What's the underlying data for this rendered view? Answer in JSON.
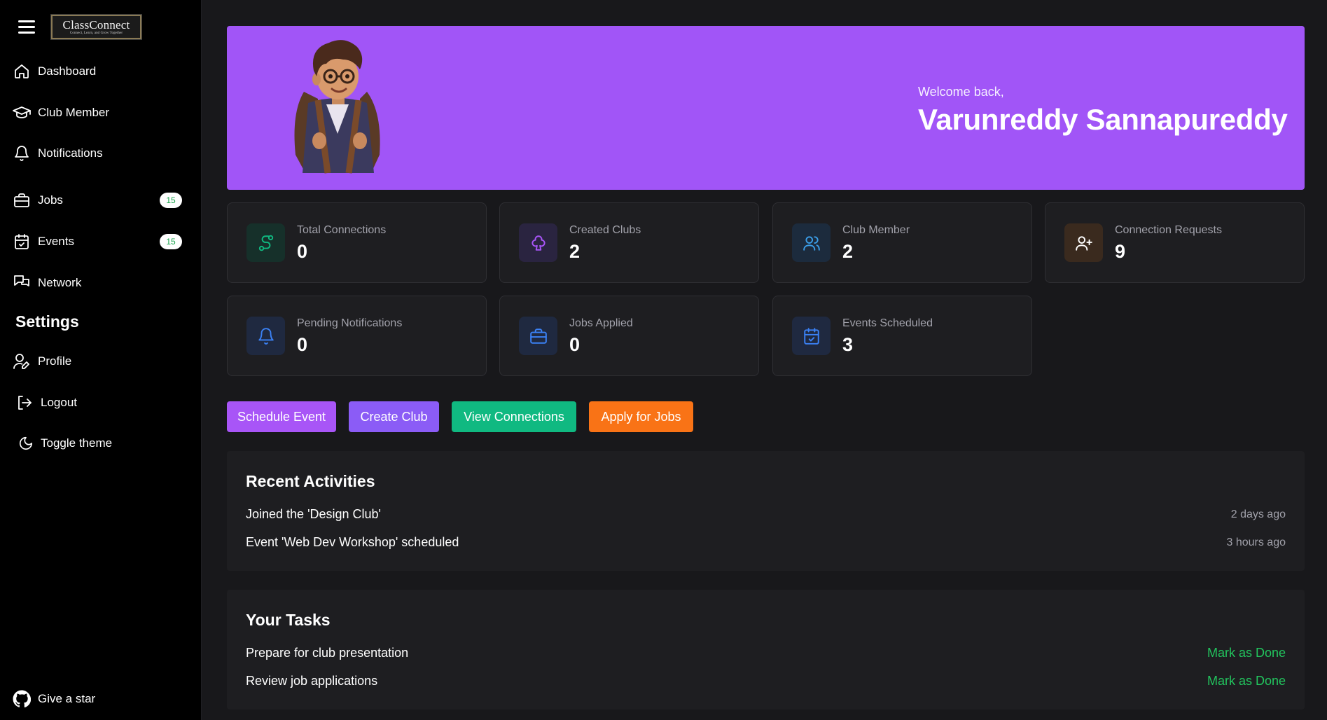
{
  "logo": {
    "title": "ClassConnect",
    "tagline": "Connect, Learn, and Grow Together"
  },
  "sidebar": {
    "items": [
      {
        "label": "Dashboard",
        "icon": "home-icon"
      },
      {
        "label": "Club Member",
        "icon": "graduation-cap-icon"
      },
      {
        "label": "Notifications",
        "icon": "bell-icon"
      },
      {
        "label": "Jobs",
        "icon": "briefcase-icon",
        "badge": "15"
      },
      {
        "label": "Events",
        "icon": "calendar-check-icon",
        "badge": "15"
      },
      {
        "label": "Network",
        "icon": "messages-icon"
      }
    ],
    "settings_title": "Settings",
    "settings_items": [
      {
        "label": "Profile",
        "icon": "user-pen-icon"
      },
      {
        "label": "Logout",
        "icon": "logout-icon"
      },
      {
        "label": "Toggle theme",
        "icon": "moon-icon"
      }
    ],
    "footer": {
      "label": "Give a star",
      "icon": "github-icon"
    }
  },
  "hero": {
    "welcome": "Welcome back,",
    "name": "Varunreddy Sannapureddy",
    "background": "#a155f7"
  },
  "stats": [
    {
      "label": "Total Connections",
      "value": "0",
      "icon": "route-icon",
      "color": "#10b981",
      "bg": "#16302a"
    },
    {
      "label": "Created Clubs",
      "value": "2",
      "icon": "club-icon",
      "color": "#a855f7",
      "bg": "#2a2440"
    },
    {
      "label": "Club Member",
      "value": "2",
      "icon": "users-icon",
      "color": "#3b9ee8",
      "bg": "#1c2b3d"
    },
    {
      "label": "Connection Requests",
      "value": "9",
      "icon": "user-plus-icon",
      "color": "#ffffff",
      "bg": "#3a2a1e"
    },
    {
      "label": "Pending Notifications",
      "value": "0",
      "icon": "bell-icon",
      "color": "#3b82f6",
      "bg": "#1f2940"
    },
    {
      "label": "Jobs Applied",
      "value": "0",
      "icon": "briefcase-icon",
      "color": "#3b82f6",
      "bg": "#1f2940"
    },
    {
      "label": "Events Scheduled",
      "value": "3",
      "icon": "calendar-check-icon",
      "color": "#3b82f6",
      "bg": "#1f2940"
    }
  ],
  "actions": [
    {
      "label": "Schedule Event",
      "color": "#a855f7"
    },
    {
      "label": "Create Club",
      "color": "#8b5cf6"
    },
    {
      "label": "View Connections",
      "color": "#10b981"
    },
    {
      "label": "Apply for Jobs",
      "color": "#f97316"
    }
  ],
  "recent": {
    "title": "Recent Activities",
    "items": [
      {
        "text": "Joined the 'Design Club'",
        "time": "2 days ago"
      },
      {
        "text": "Event 'Web Dev Workshop' scheduled",
        "time": "3 hours ago"
      }
    ]
  },
  "tasks": {
    "title": "Your Tasks",
    "items": [
      {
        "text": "Prepare for club presentation",
        "action": "Mark as Done"
      },
      {
        "text": "Review job applications",
        "action": "Mark as Done"
      }
    ]
  }
}
